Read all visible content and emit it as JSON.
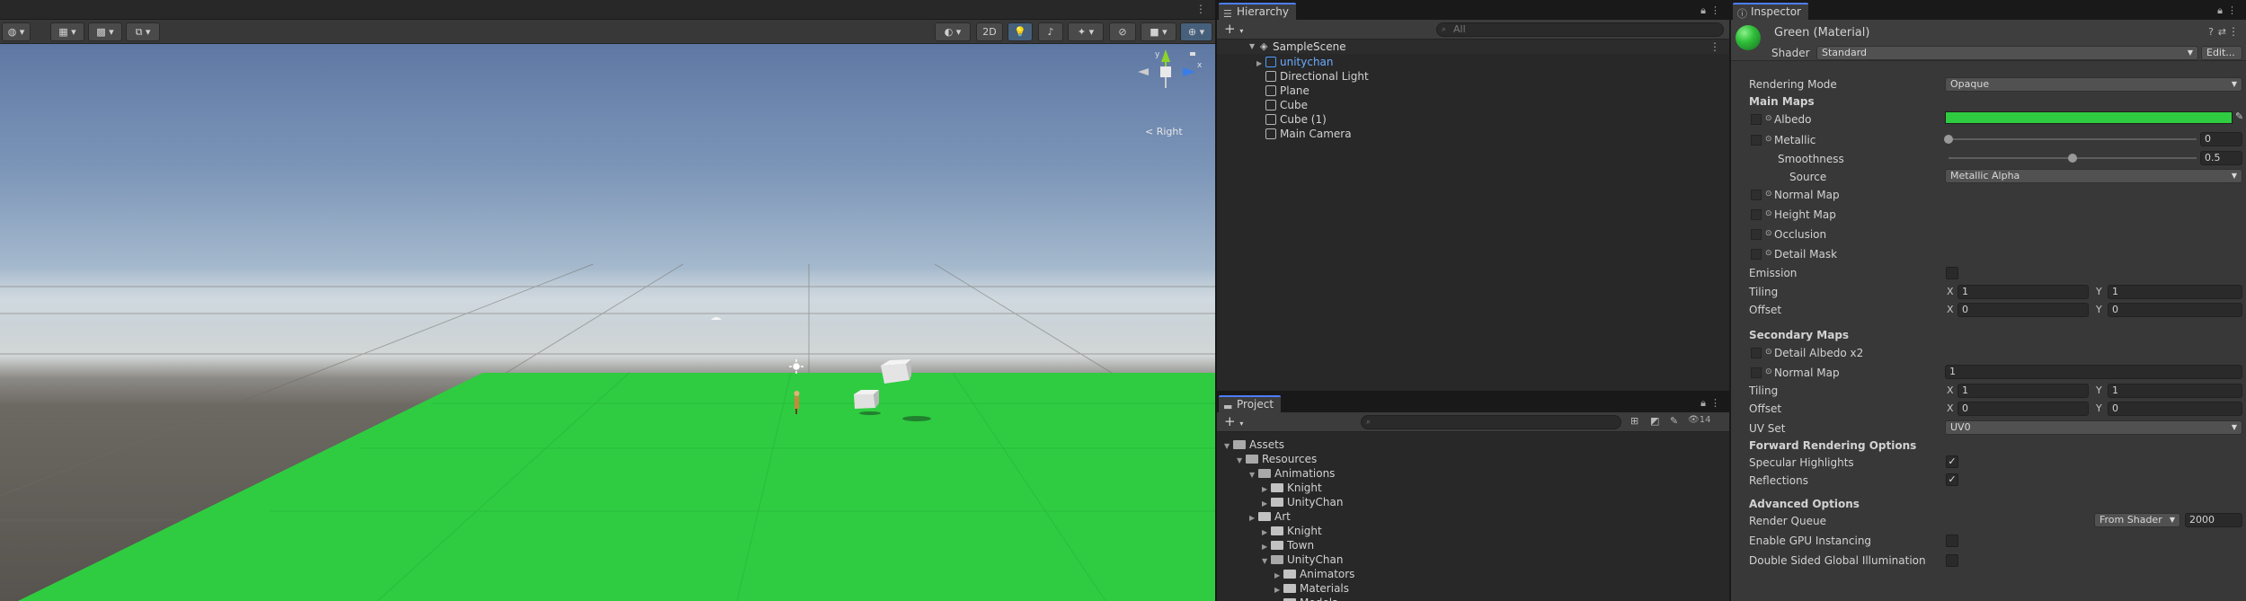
{
  "scene": {
    "toolbar": {
      "btn_2d": "2D"
    },
    "gizmo": {
      "view_label": "Right",
      "axis_x": "x",
      "axis_y": "y"
    },
    "icons": [
      "globe-icon",
      "grid-snap-icon",
      "grid-icon",
      "transform-icon",
      "draw-mode-icon",
      "light-icon",
      "audio-icon",
      "effects-icon",
      "visibility-icon",
      "camera-icon",
      "gizmos-icon"
    ],
    "colors": {
      "sky_top": "#5e78a4",
      "plane": "#2fcc41",
      "ground": "#57534e"
    }
  },
  "hierarchy": {
    "tab_label": "Hierarchy",
    "search_placeholder": "All",
    "scene_name": "SampleScene",
    "items": [
      {
        "label": "unitychan",
        "color": "#4f9bff"
      },
      {
        "label": "Directional Light"
      },
      {
        "label": "Plane"
      },
      {
        "label": "Cube"
      },
      {
        "label": "Cube (1)"
      },
      {
        "label": "Main Camera"
      }
    ]
  },
  "project": {
    "tab_label": "Project",
    "visible_count": "14",
    "tree": [
      {
        "label": "Assets",
        "depth": 0
      },
      {
        "label": "Resources",
        "depth": 1
      },
      {
        "label": "Animations",
        "depth": 2
      },
      {
        "label": "Knight",
        "depth": 3
      },
      {
        "label": "UnityChan",
        "depth": 3
      },
      {
        "label": "Art",
        "depth": 2
      },
      {
        "label": "Knight",
        "depth": 3
      },
      {
        "label": "Town",
        "depth": 3
      },
      {
        "label": "UnityChan",
        "depth": 3
      },
      {
        "label": "Animators",
        "depth": 4
      },
      {
        "label": "Materials",
        "depth": 4
      },
      {
        "label": "Models",
        "depth": 4
      }
    ]
  },
  "inspector": {
    "tab_label": "Inspector",
    "title": "Green (Material)",
    "shader_label": "Shader",
    "shader_value": "Standard",
    "edit_button": "Edit...",
    "rendering_mode_label": "Rendering Mode",
    "rendering_mode_value": "Opaque",
    "main_maps": "Main Maps",
    "albedo": "Albedo",
    "albedo_color": "#2fcc41",
    "metallic": "Metallic",
    "metallic_value": "0",
    "smoothness": "Smoothness",
    "smoothness_value": "0.5",
    "source": "Source",
    "source_value": "Metallic Alpha",
    "normal_map": "Normal Map",
    "height_map": "Height Map",
    "occlusion": "Occlusion",
    "detail_mask": "Detail Mask",
    "emission": "Emission",
    "tiling": "Tiling",
    "offset": "Offset",
    "main_tiling": {
      "x": "1",
      "y": "1"
    },
    "main_offset": {
      "x": "0",
      "y": "0"
    },
    "secondary_maps": "Secondary Maps",
    "detail_albedo": "Detail Albedo x2",
    "secondary_normal_map": "Normal Map",
    "secondary_normal_value": "1",
    "sec_tiling": {
      "x": "1",
      "y": "1"
    },
    "sec_offset": {
      "x": "0",
      "y": "0"
    },
    "uv_set": "UV Set",
    "uv_set_value": "UV0",
    "forward_options": "Forward Rendering Options",
    "specular_highlights": "Specular Highlights",
    "reflections": "Reflections",
    "advanced_options": "Advanced Options",
    "render_queue": "Render Queue",
    "render_queue_mode": "From Shader",
    "render_queue_value": "2000",
    "gpu_instancing": "Enable GPU Instancing",
    "double_sided_gi": "Double Sided Global Illumination",
    "label_x": "X",
    "label_y": "Y",
    "checkmark": "✓"
  }
}
